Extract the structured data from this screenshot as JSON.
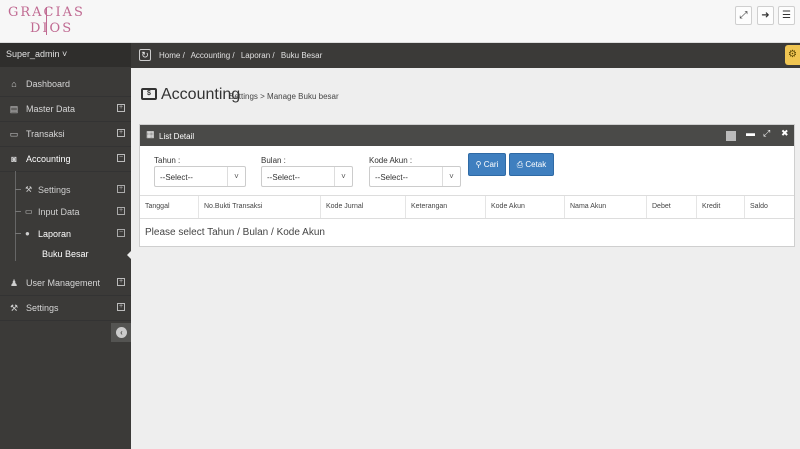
{
  "header": {
    "logo_line1": "GRACIAS",
    "logo_line2": "DIOS",
    "buttons": [
      {
        "name": "fullscreen-button",
        "glyph": "⤢"
      },
      {
        "name": "logout-button",
        "glyph": "➜"
      },
      {
        "name": "menu-button",
        "glyph": "☰"
      }
    ]
  },
  "sidebar": {
    "user": "Super_admin ˅",
    "items": [
      {
        "label": "Dashboard",
        "icon": "⌂"
      },
      {
        "label": "Master Data",
        "icon": "▤"
      },
      {
        "label": "Transaksi",
        "icon": "▭"
      },
      {
        "label": "Accounting",
        "icon": "◙"
      },
      {
        "label": "User Management",
        "icon": "♟"
      },
      {
        "label": "Settings",
        "icon": "⚒"
      }
    ],
    "sub_items": [
      {
        "label": "Settings",
        "icon": "⚒"
      },
      {
        "label": "Input Data",
        "icon": "▭"
      },
      {
        "label": "Laporan",
        "icon": "●"
      }
    ],
    "sub_sub_item": "Buku Besar"
  },
  "breadcrumb": {
    "items": [
      "Home /",
      "Accounting /",
      "Laporan /",
      "Buku Besar"
    ]
  },
  "page": {
    "title": "Accounting",
    "subtitle": "Settings > Manage Buku besar"
  },
  "panel": {
    "title": "List Detail",
    "filters": {
      "tahun_label": "Tahun :",
      "bulan_label": "Bulan :",
      "kode_label": "Kode Akun :",
      "select_value": "--Select--"
    },
    "buttons": {
      "cari": "Cari",
      "cetak": "Cetak"
    },
    "columns": [
      "Tanggal",
      "No.Bukti Transaksi",
      "Kode Jurnal",
      "Keterangan",
      "Kode Akun",
      "Nama Akun",
      "Debet",
      "Kredit",
      "Saldo"
    ],
    "empty_message": "Please select Tahun / Bulan / Kode Akun"
  },
  "colors": {
    "sidebar": "#3b3a38",
    "primary_button": "#3f7fbf",
    "logo": "#c06a92",
    "settings_tab": "#f0c552"
  }
}
